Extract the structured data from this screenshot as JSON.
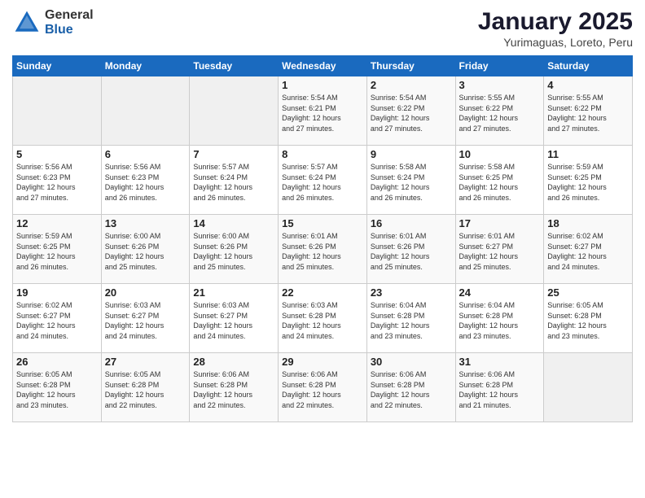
{
  "logo": {
    "general": "General",
    "blue": "Blue"
  },
  "title": "January 2025",
  "subtitle": "Yurimaguas, Loreto, Peru",
  "headers": [
    "Sunday",
    "Monday",
    "Tuesday",
    "Wednesday",
    "Thursday",
    "Friday",
    "Saturday"
  ],
  "weeks": [
    [
      {
        "day": "",
        "info": ""
      },
      {
        "day": "",
        "info": ""
      },
      {
        "day": "",
        "info": ""
      },
      {
        "day": "1",
        "info": "Sunrise: 5:54 AM\nSunset: 6:21 PM\nDaylight: 12 hours\nand 27 minutes."
      },
      {
        "day": "2",
        "info": "Sunrise: 5:54 AM\nSunset: 6:22 PM\nDaylight: 12 hours\nand 27 minutes."
      },
      {
        "day": "3",
        "info": "Sunrise: 5:55 AM\nSunset: 6:22 PM\nDaylight: 12 hours\nand 27 minutes."
      },
      {
        "day": "4",
        "info": "Sunrise: 5:55 AM\nSunset: 6:22 PM\nDaylight: 12 hours\nand 27 minutes."
      }
    ],
    [
      {
        "day": "5",
        "info": "Sunrise: 5:56 AM\nSunset: 6:23 PM\nDaylight: 12 hours\nand 27 minutes."
      },
      {
        "day": "6",
        "info": "Sunrise: 5:56 AM\nSunset: 6:23 PM\nDaylight: 12 hours\nand 26 minutes."
      },
      {
        "day": "7",
        "info": "Sunrise: 5:57 AM\nSunset: 6:24 PM\nDaylight: 12 hours\nand 26 minutes."
      },
      {
        "day": "8",
        "info": "Sunrise: 5:57 AM\nSunset: 6:24 PM\nDaylight: 12 hours\nand 26 minutes."
      },
      {
        "day": "9",
        "info": "Sunrise: 5:58 AM\nSunset: 6:24 PM\nDaylight: 12 hours\nand 26 minutes."
      },
      {
        "day": "10",
        "info": "Sunrise: 5:58 AM\nSunset: 6:25 PM\nDaylight: 12 hours\nand 26 minutes."
      },
      {
        "day": "11",
        "info": "Sunrise: 5:59 AM\nSunset: 6:25 PM\nDaylight: 12 hours\nand 26 minutes."
      }
    ],
    [
      {
        "day": "12",
        "info": "Sunrise: 5:59 AM\nSunset: 6:25 PM\nDaylight: 12 hours\nand 26 minutes."
      },
      {
        "day": "13",
        "info": "Sunrise: 6:00 AM\nSunset: 6:26 PM\nDaylight: 12 hours\nand 25 minutes."
      },
      {
        "day": "14",
        "info": "Sunrise: 6:00 AM\nSunset: 6:26 PM\nDaylight: 12 hours\nand 25 minutes."
      },
      {
        "day": "15",
        "info": "Sunrise: 6:01 AM\nSunset: 6:26 PM\nDaylight: 12 hours\nand 25 minutes."
      },
      {
        "day": "16",
        "info": "Sunrise: 6:01 AM\nSunset: 6:26 PM\nDaylight: 12 hours\nand 25 minutes."
      },
      {
        "day": "17",
        "info": "Sunrise: 6:01 AM\nSunset: 6:27 PM\nDaylight: 12 hours\nand 25 minutes."
      },
      {
        "day": "18",
        "info": "Sunrise: 6:02 AM\nSunset: 6:27 PM\nDaylight: 12 hours\nand 24 minutes."
      }
    ],
    [
      {
        "day": "19",
        "info": "Sunrise: 6:02 AM\nSunset: 6:27 PM\nDaylight: 12 hours\nand 24 minutes."
      },
      {
        "day": "20",
        "info": "Sunrise: 6:03 AM\nSunset: 6:27 PM\nDaylight: 12 hours\nand 24 minutes."
      },
      {
        "day": "21",
        "info": "Sunrise: 6:03 AM\nSunset: 6:27 PM\nDaylight: 12 hours\nand 24 minutes."
      },
      {
        "day": "22",
        "info": "Sunrise: 6:03 AM\nSunset: 6:28 PM\nDaylight: 12 hours\nand 24 minutes."
      },
      {
        "day": "23",
        "info": "Sunrise: 6:04 AM\nSunset: 6:28 PM\nDaylight: 12 hours\nand 23 minutes."
      },
      {
        "day": "24",
        "info": "Sunrise: 6:04 AM\nSunset: 6:28 PM\nDaylight: 12 hours\nand 23 minutes."
      },
      {
        "day": "25",
        "info": "Sunrise: 6:05 AM\nSunset: 6:28 PM\nDaylight: 12 hours\nand 23 minutes."
      }
    ],
    [
      {
        "day": "26",
        "info": "Sunrise: 6:05 AM\nSunset: 6:28 PM\nDaylight: 12 hours\nand 23 minutes."
      },
      {
        "day": "27",
        "info": "Sunrise: 6:05 AM\nSunset: 6:28 PM\nDaylight: 12 hours\nand 22 minutes."
      },
      {
        "day": "28",
        "info": "Sunrise: 6:06 AM\nSunset: 6:28 PM\nDaylight: 12 hours\nand 22 minutes."
      },
      {
        "day": "29",
        "info": "Sunrise: 6:06 AM\nSunset: 6:28 PM\nDaylight: 12 hours\nand 22 minutes."
      },
      {
        "day": "30",
        "info": "Sunrise: 6:06 AM\nSunset: 6:28 PM\nDaylight: 12 hours\nand 22 minutes."
      },
      {
        "day": "31",
        "info": "Sunrise: 6:06 AM\nSunset: 6:28 PM\nDaylight: 12 hours\nand 21 minutes."
      },
      {
        "day": "",
        "info": ""
      }
    ]
  ]
}
